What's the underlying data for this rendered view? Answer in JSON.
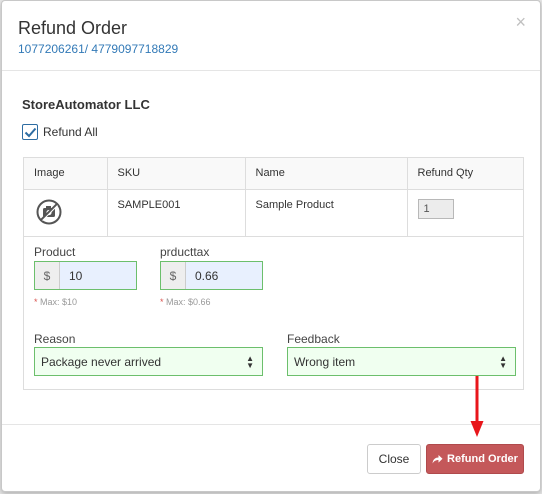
{
  "modal": {
    "title": "Refund Order",
    "subtitle": "1077206261/ 4779097718829",
    "close_glyph": "×",
    "close_icon": "close-icon"
  },
  "body": {
    "company": "StoreAutomator LLC",
    "refund_all_label": "Refund All",
    "refund_all_checked": true
  },
  "table": {
    "headers": [
      "Image",
      "SKU",
      "Name",
      "Refund Qty"
    ],
    "rows": [
      {
        "image_icon": "no-camera-icon",
        "sku": "SAMPLE001",
        "name": "Sample Product",
        "refund_qty": "1"
      }
    ]
  },
  "amounts": {
    "product": {
      "label": "Product",
      "currency": "$",
      "value": "10",
      "max_note": "Max: $10"
    },
    "tax": {
      "label": "prducttax",
      "currency": "$",
      "value": "0.66",
      "max_note": "Max: $0.66"
    },
    "required_marker": "*"
  },
  "reason": {
    "label": "Reason",
    "selected": "Package never arrived"
  },
  "feedback": {
    "label": "Feedback",
    "selected": "Wrong item"
  },
  "footer": {
    "close_label": "Close",
    "refund_label": "Refund Order",
    "refund_icon": "share-arrow-icon"
  },
  "colors": {
    "accent_link": "#337ab7",
    "refund_button": "#c4585a",
    "valid_border": "#6cbf6c",
    "annotation_arrow": "#e8161b"
  }
}
